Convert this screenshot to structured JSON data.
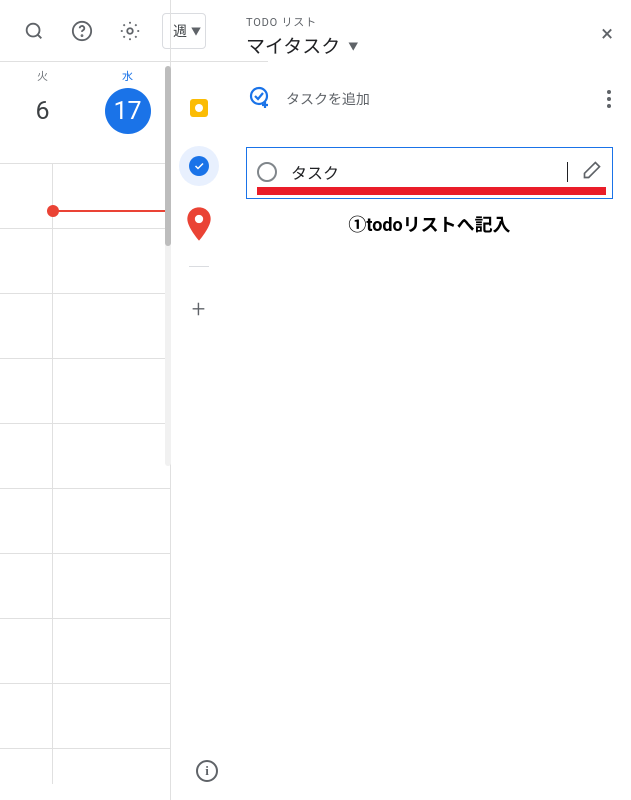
{
  "toolbar": {
    "view_label": "週"
  },
  "days": [
    {
      "dow": "火",
      "date": "6"
    },
    {
      "dow": "水",
      "date": "17"
    }
  ],
  "panel": {
    "small_title": "TODO リスト",
    "list_name": "マイタスク",
    "add_label": "タスクを追加",
    "task_text": "タスク",
    "annotation": "①todoリストへ記入"
  },
  "icons": {
    "close": "×",
    "plus": "+",
    "info": "i"
  }
}
